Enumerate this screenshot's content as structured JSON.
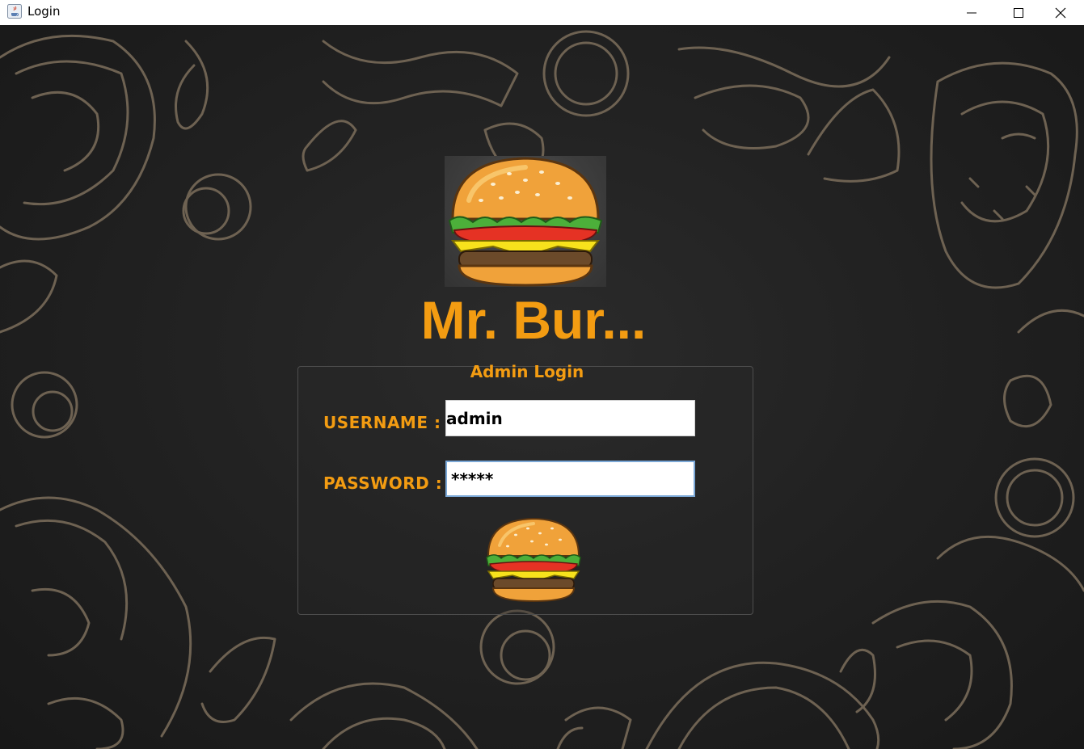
{
  "window": {
    "title": "Login",
    "icon": "java-cup-icon",
    "controls": [
      "minimize-icon",
      "maximize-icon",
      "close-icon"
    ]
  },
  "brand": {
    "logo": "burger-icon",
    "title": "Mr. Bur..."
  },
  "login_panel": {
    "title": "Admin Login",
    "username_label": "USERNAME :",
    "username_value": "admin",
    "password_label": "PASSWORD :",
    "password_value": "*****",
    "submit_icon": "burger-icon"
  },
  "colors": {
    "accent": "#f39c12",
    "background": "#1e1e1e",
    "doodle_stroke": "#6e6252"
  }
}
